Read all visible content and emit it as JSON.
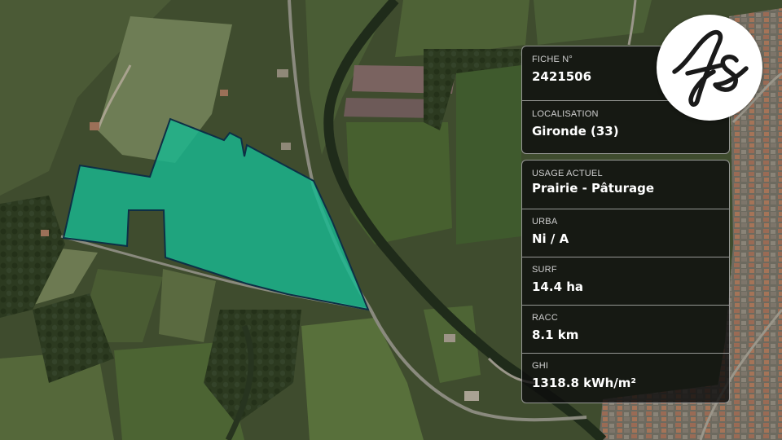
{
  "fiche": {
    "label": "FICHE N°",
    "value": "2421506"
  },
  "localisation": {
    "label": "LOCALISATION",
    "value": "Gironde (33)"
  },
  "details": [
    {
      "key": "usage",
      "label": "USAGE ACTUEL",
      "value": "Prairie - Pâturage"
    },
    {
      "key": "urba",
      "label": "URBA",
      "value": "Ni / A"
    },
    {
      "key": "surf",
      "label": "SURF",
      "value": "14.4 ha"
    },
    {
      "key": "racc",
      "label": "RACC",
      "value": "8.1 km"
    },
    {
      "key": "ghi",
      "label": "GHI",
      "value": "1318.8 kWh/m²"
    }
  ],
  "colors": {
    "parcel_fill": "#19b890",
    "parcel_stroke": "#0d2f45",
    "card_background": "#0c0c0c",
    "logo_background": "#ffffff",
    "logo_ink": "#1a1a1a"
  },
  "logo": {
    "icon": "fs-monogram-logo"
  }
}
